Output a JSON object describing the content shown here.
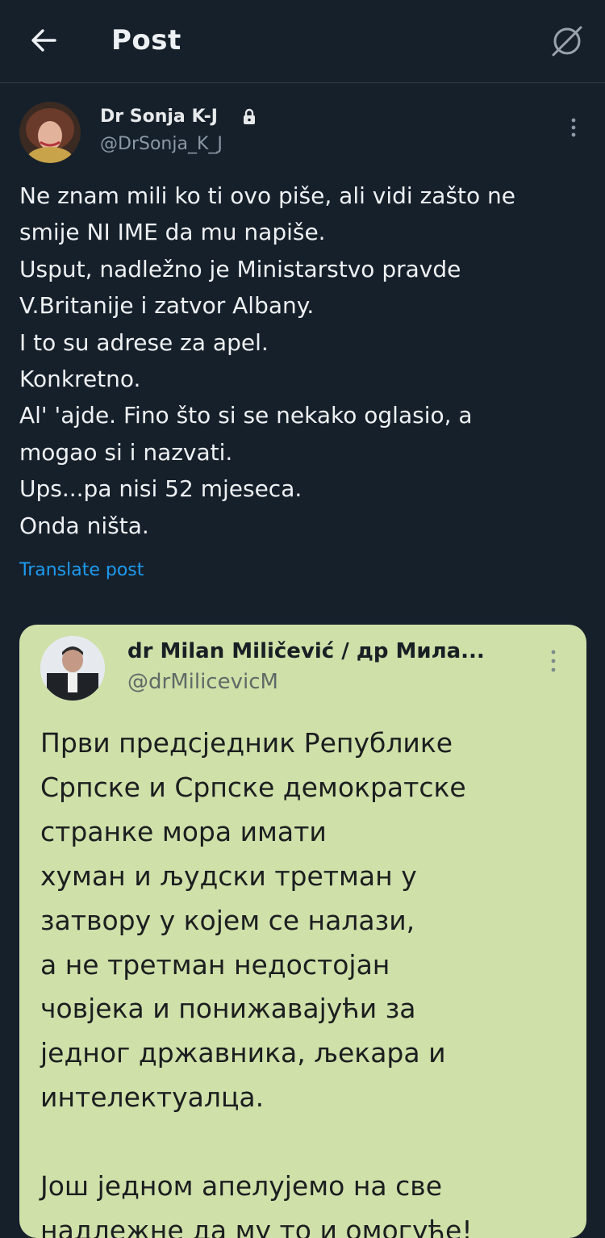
{
  "header": {
    "title": "Post"
  },
  "post": {
    "author_name": "Dr Sonja K-J",
    "author_handle": "@DrSonja_K_J",
    "text": "Ne znam mili ko ti ovo piše, ali vidi zašto ne\nsmije NI IME da mu napiše.\nUsput, nadležno je Ministarstvo pravde\nV.Britanije i zatvor Albany.\nI to su adrese za apel.\nKonkretno.\nAl' 'ajde. Fino što si se nekako oglasio, a\nmogao si i nazvati.\nUps...pa nisi 52 mjeseca.\nOnda ništa.",
    "translate_label": "Translate post"
  },
  "quoted": {
    "author_name": "dr Milan Miličević / др Мила...",
    "author_handle": "@drMilicevicM",
    "text": "Први предсједник Републике\nСрпске и Српске демократске\nстранке мора имати\nхуман и људски третман у\nзатвору у којем се налази,\nа не третман недостојан\nчовјека и понижавајући за\nједног државника, љекара и\nинтелектуалца.\n\nЈош једном апелујемо на све\nнадлежне да му то и омогуће!"
  },
  "colors": {
    "background": "#16202b",
    "accent": "#1d9bf0",
    "card": "#cfe0a9"
  },
  "icons": {
    "back": "arrow-left-icon",
    "topright": "no-sign-icon",
    "lock": "lock-icon",
    "more": "more-vertical-icon"
  }
}
